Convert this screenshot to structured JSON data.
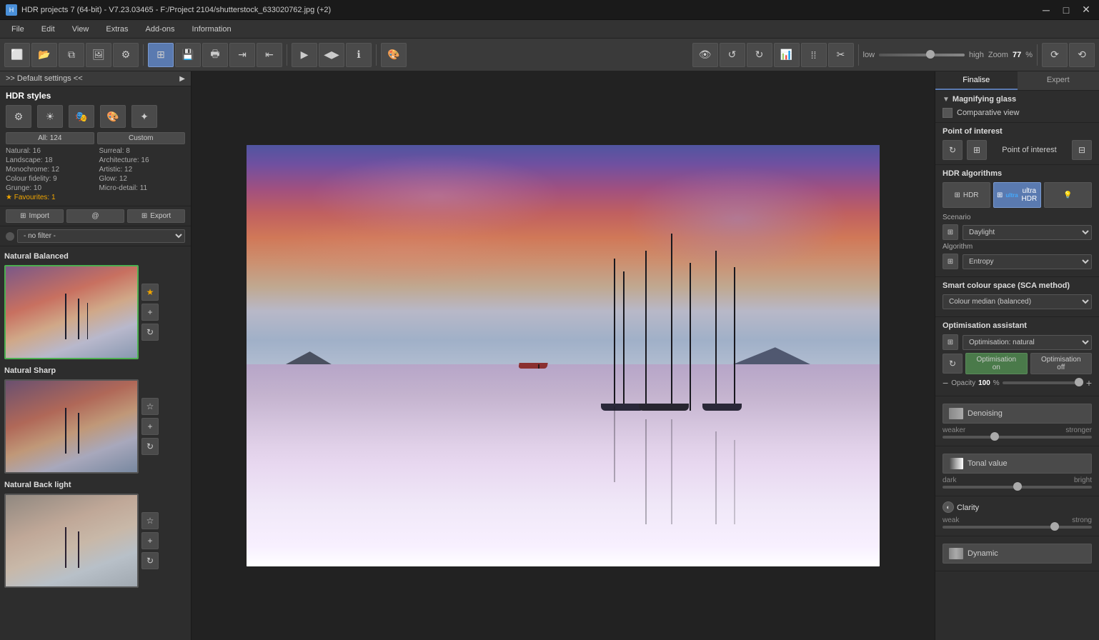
{
  "titlebar": {
    "title": "HDR projects 7 (64-bit) - V7.23.03465 - F:/Project 2104/shutterstock_633020762.jpg (+2)",
    "min_label": "─",
    "max_label": "□",
    "close_label": "✕"
  },
  "menubar": {
    "items": [
      "File",
      "Edit",
      "View",
      "Extras",
      "Add-ons",
      "Information"
    ]
  },
  "toolbar": {
    "zoom_label": "Zoom",
    "zoom_value": "77",
    "zoom_unit": "%",
    "zoom_low": "low",
    "zoom_high": "high"
  },
  "left_panel": {
    "header": ">> Default settings <<",
    "hdr_styles_title": "HDR styles",
    "categories": {
      "all": "All: 124",
      "custom": "Custom"
    },
    "stats": {
      "natural": "Natural: 16",
      "surreal": "Surreal: 8",
      "landscape": "Landscape: 18",
      "architecture": "Architecture: 16",
      "monochrome": "Monochrome: 12",
      "artistic": "Artistic: 12",
      "colour_fidelity": "Colour fidelity: 9",
      "glow": "Glow: 12",
      "grunge": "Grunge: 10",
      "micro_detail": "Micro-detail: 11"
    },
    "favourites": "★ Favourites: 1",
    "import_label": "Import",
    "export_label": "Export",
    "filter_label": "- no filter -",
    "styles": [
      {
        "name": "Natural Balanced",
        "selected": true
      },
      {
        "name": "Natural Sharp",
        "selected": false
      },
      {
        "name": "Natural Back light",
        "selected": false
      }
    ]
  },
  "right_panel": {
    "tab_finalise": "Finalise",
    "tab_expert": "Expert",
    "magnifying_glass": {
      "title": "Magnifying glass",
      "arrow": "▼"
    },
    "comparative_view": {
      "label": "Comparative view",
      "checked": false
    },
    "point_of_interest": {
      "title": "Point of interest",
      "label": "Point of interest"
    },
    "hdr_algorithms": {
      "title": "HDR algorithms",
      "hdr_label": "HDR",
      "ultra_hdr_label": "ultra HDR",
      "scenario_label": "Scenario",
      "scenario_value": "Daylight",
      "algorithm_label": "Algorithm",
      "algorithm_value": "Entropy"
    },
    "smart_colour": {
      "title": "Smart colour space (SCA method)",
      "value": "Colour median (balanced)"
    },
    "optimisation": {
      "title": "Optimisation assistant",
      "value": "Optimisation: natural",
      "on_label": "Optimisation on",
      "off_label": "Optimisation off",
      "opacity_label": "Opacity",
      "opacity_value": "100",
      "opacity_unit": "%"
    },
    "denoising": {
      "label": "Denoising",
      "weaker": "weaker",
      "stronger": "stronger"
    },
    "tonal": {
      "label": "Tonal value",
      "dark": "dark",
      "bright": "bright"
    },
    "clarity": {
      "label": "Clarity",
      "weak": "weak",
      "strong": "strong"
    },
    "dynamic": {
      "label": "Dynamic"
    }
  }
}
